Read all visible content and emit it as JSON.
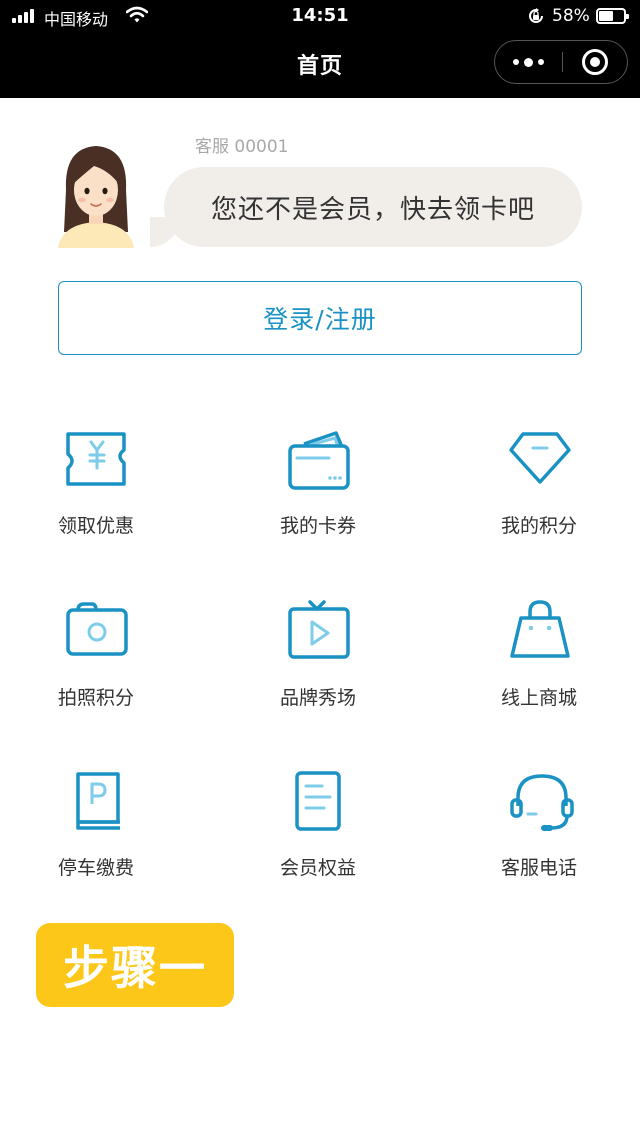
{
  "status_bar": {
    "carrier": "中国移动",
    "time": "14:51",
    "battery_percent": "58%",
    "battery_level": 0.58,
    "icons": [
      "signal-icon",
      "wifi-icon",
      "rotation-lock-icon",
      "battery-icon"
    ]
  },
  "nav": {
    "title": "首页",
    "more_icon": "more-dots-icon",
    "close_icon": "mini-program-close-icon"
  },
  "service": {
    "agent_name": "客服 00001",
    "message": "您还不是会员，快去领卡吧"
  },
  "login": {
    "label": "登录/注册"
  },
  "accent_color": "#1a92c3",
  "menu": [
    {
      "label": "领取优惠",
      "icon": "coupon-ticket-icon"
    },
    {
      "label": "我的卡券",
      "icon": "wallet-cards-icon"
    },
    {
      "label": "我的积分",
      "icon": "diamond-icon"
    },
    {
      "label": "拍照积分",
      "icon": "camera-icon"
    },
    {
      "label": "品牌秀场",
      "icon": "tv-play-icon"
    },
    {
      "label": "线上商城",
      "icon": "shopping-bag-icon"
    },
    {
      "label": "停车缴费",
      "icon": "parking-book-icon"
    },
    {
      "label": "会员权益",
      "icon": "document-icon"
    },
    {
      "label": "客服电话",
      "icon": "headset-icon"
    }
  ],
  "step_badge": {
    "text": "步骤一",
    "color": "#fcc718"
  }
}
